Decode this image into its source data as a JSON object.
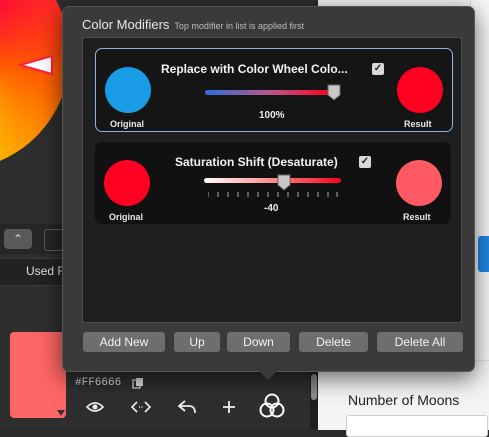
{
  "popover": {
    "title": "Color Modifiers",
    "subtitle": "Top modifier in list is applied first",
    "modifiers": [
      {
        "name": "Replace with Color Wheel Colo...",
        "checked": true,
        "original_label": "Original",
        "result_label": "Result",
        "original_color": "#1a9be6",
        "result_color": "#ff0020",
        "value_text": "100%",
        "value": 100,
        "selected": true
      },
      {
        "name": "Saturation Shift (Desaturate)",
        "checked": true,
        "original_label": "Original",
        "result_label": "Result",
        "original_color": "#ff0020",
        "result_color": "#ff5a64",
        "value_text": "-40",
        "value": -40,
        "selected": false
      }
    ],
    "buttons": {
      "add_new": "Add New",
      "up": "Up",
      "down": "Down",
      "delete": "Delete",
      "delete_all": "Delete All"
    }
  },
  "background": {
    "used_label": "Used F",
    "hex_value": "#FF6666",
    "swatch_color": "#ff6666",
    "right_panel": {
      "number_of_moons_label": "Number of Moons"
    }
  },
  "icons": {
    "toolbar": [
      "eye-icon",
      "code-arrows-icon",
      "undo-arrow-icon",
      "add-icon",
      "color-modifiers-icon"
    ],
    "copy": "copy-icon",
    "checkbox": "checkmark-icon"
  },
  "colors": {
    "accent_blue": "#1e88e5",
    "selection_border": "#8fb4e0"
  }
}
